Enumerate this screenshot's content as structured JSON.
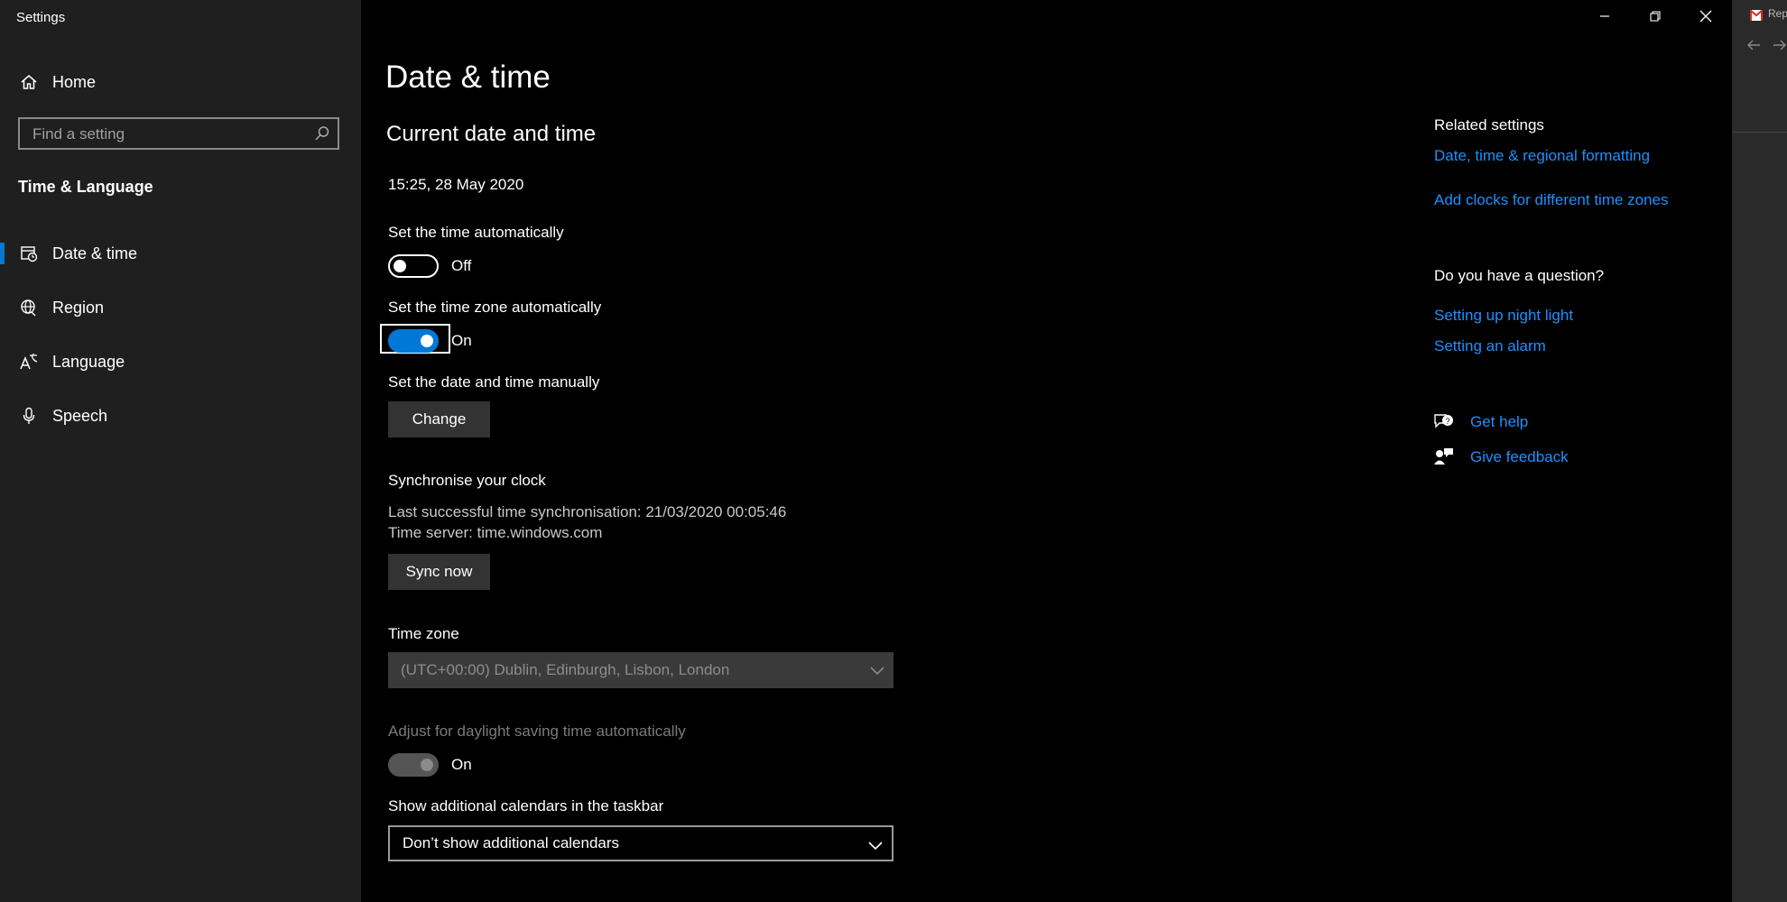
{
  "window": {
    "title": "Settings",
    "controls": {
      "minimize": "minimize",
      "maximize": "restore",
      "close": "close"
    }
  },
  "sidebar": {
    "home": "Home",
    "search_placeholder": "Find a setting",
    "section_title": "Time & Language",
    "items": [
      {
        "label": "Date & time",
        "icon": "calendar-clock-icon",
        "selected": true
      },
      {
        "label": "Region",
        "icon": "globe-icon",
        "selected": false
      },
      {
        "label": "Language",
        "icon": "language-icon",
        "selected": false
      },
      {
        "label": "Speech",
        "icon": "microphone-icon",
        "selected": false
      }
    ]
  },
  "main": {
    "page_title": "Date & time",
    "section_title": "Current date and time",
    "current_datetime": "15:25, 28 May 2020",
    "auto_time": {
      "label": "Set the time automatically",
      "state": "Off"
    },
    "auto_timezone": {
      "label": "Set the time zone automatically",
      "state": "On"
    },
    "manual": {
      "label": "Set the date and time manually",
      "button": "Change"
    },
    "sync": {
      "title": "Synchronise your clock",
      "last_sync": "Last successful time synchronisation: 21/03/2020 00:05:46",
      "server": "Time server: time.windows.com",
      "button": "Sync now"
    },
    "timezone": {
      "label": "Time zone",
      "value": "(UTC+00:00) Dublin, Edinburgh, Lisbon, London"
    },
    "dst": {
      "label": "Adjust for daylight saving time automatically",
      "state": "On"
    },
    "calendars": {
      "label": "Show additional calendars in the taskbar",
      "value": "Don’t show additional calendars"
    }
  },
  "related": {
    "heading": "Related settings",
    "links": [
      "Date, time & regional formatting",
      "Add clocks for different time zones"
    ],
    "question_heading": "Do you have a question?",
    "question_links": [
      "Setting up night light",
      "Setting an alarm"
    ],
    "get_help": "Get help",
    "give_feedback": "Give feedback"
  },
  "other_window": {
    "tab_text": "Rep"
  },
  "colors": {
    "accent": "#0078d7",
    "link": "#1e90ff",
    "sidebar_bg": "#1f1f1f",
    "main_bg": "#000000"
  }
}
